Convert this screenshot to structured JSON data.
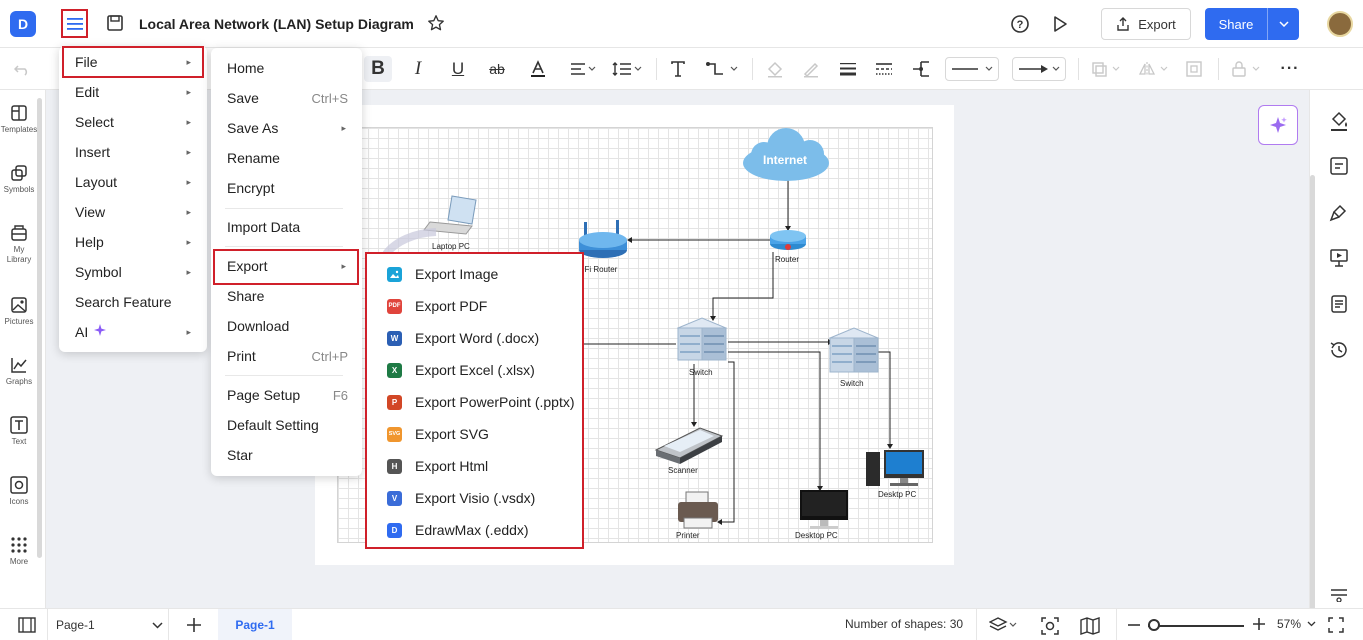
{
  "app": {
    "title": "Local Area Network (LAN) Setup Diagram",
    "logo_text": "D",
    "export_label": "Export",
    "share_label": "Share"
  },
  "colors": {
    "accent": "#2f6bf0",
    "highlight": "#d0202a",
    "ai": "#b07bf0"
  },
  "left_sidebar": {
    "items": [
      {
        "label": "Templates",
        "icon": "templates-icon"
      },
      {
        "label": "Symbols",
        "icon": "symbols-icon"
      },
      {
        "label": "My Library",
        "icon": "library-icon"
      },
      {
        "label": "Pictures",
        "icon": "pictures-icon"
      },
      {
        "label": "Graphs",
        "icon": "graphs-icon"
      },
      {
        "label": "Text",
        "icon": "text-icon"
      },
      {
        "label": "Icons",
        "icon": "icons-icon"
      },
      {
        "label": "More",
        "icon": "more-icon"
      }
    ]
  },
  "file_menu": {
    "items": [
      {
        "label": "File",
        "submenu": true
      },
      {
        "label": "Edit",
        "submenu": true
      },
      {
        "label": "Select",
        "submenu": true
      },
      {
        "label": "Insert",
        "submenu": true
      },
      {
        "label": "Layout",
        "submenu": true
      },
      {
        "label": "View",
        "submenu": true
      },
      {
        "label": "Help",
        "submenu": true
      },
      {
        "label": "Symbol",
        "submenu": true
      },
      {
        "label": "Search Feature",
        "submenu": false
      },
      {
        "label": "AI",
        "submenu": true
      }
    ]
  },
  "file_submenu": {
    "items": [
      {
        "label": "Home",
        "shortcut": ""
      },
      {
        "label": "Save",
        "shortcut": "Ctrl+S"
      },
      {
        "label": "Save As",
        "shortcut": "",
        "submenu": true
      },
      {
        "label": "Rename",
        "shortcut": ""
      },
      {
        "label": "Encrypt",
        "shortcut": ""
      },
      {
        "label": "Import Data",
        "shortcut": ""
      },
      {
        "label": "Export",
        "shortcut": "",
        "submenu": true
      },
      {
        "label": "Share",
        "shortcut": ""
      },
      {
        "label": "Download",
        "shortcut": ""
      },
      {
        "label": "Print",
        "shortcut": "Ctrl+P"
      },
      {
        "label": "Page Setup",
        "shortcut": "F6"
      },
      {
        "label": "Default Setting",
        "shortcut": ""
      },
      {
        "label": "Star",
        "shortcut": ""
      }
    ]
  },
  "export_submenu": {
    "items": [
      {
        "label": "Export Image",
        "badge": "",
        "color": "#1aa3d8"
      },
      {
        "label": "Export PDF",
        "badge": "PDF",
        "color": "#e0443c"
      },
      {
        "label": "Export Word (.docx)",
        "badge": "W",
        "color": "#2b5fb4"
      },
      {
        "label": "Export Excel (.xlsx)",
        "badge": "X",
        "color": "#1e7a45"
      },
      {
        "label": "Export PowerPoint (.pptx)",
        "badge": "P",
        "color": "#d24726"
      },
      {
        "label": "Export SVG",
        "badge": "SVG",
        "color": "#f0962e"
      },
      {
        "label": "Export Html",
        "badge": "H",
        "color": "#555555"
      },
      {
        "label": "Export Visio (.vsdx)",
        "badge": "V",
        "color": "#3a6cd8"
      },
      {
        "label": "EdrawMax (.eddx)",
        "badge": "D",
        "color": "#2f6bf0"
      }
    ]
  },
  "diagram": {
    "labels": {
      "internet": "Internet",
      "router": "Router",
      "wifi_router": "i-Fi Router",
      "laptop": "Laptop PC",
      "switch1": "Switch",
      "switch2": "Switch",
      "scanner": "Scanner",
      "printer": "Printer",
      "desktop1": "Desktop PC",
      "desktop2": "Desktp PC"
    }
  },
  "bottom_bar": {
    "page_select": "Page-1",
    "page_tab": "Page-1",
    "shape_count": "Number of shapes: 30",
    "zoom": "57%"
  }
}
